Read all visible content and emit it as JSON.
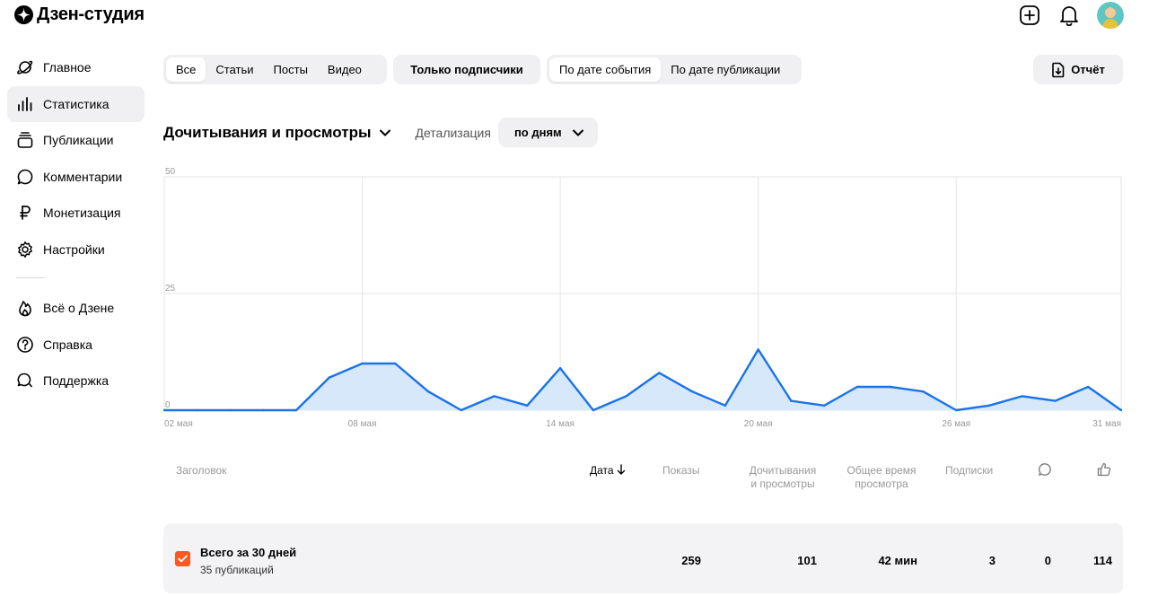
{
  "brand": {
    "name": "Дзен-студия"
  },
  "topbar": {
    "add_icon": "plus-square-icon",
    "bell_icon": "bell-icon"
  },
  "sidebar": {
    "items": [
      {
        "label": "Главное",
        "icon": "planet-icon"
      },
      {
        "label": "Статистика",
        "icon": "bar-chart-icon",
        "active": true
      },
      {
        "label": "Публикации",
        "icon": "stack-icon"
      },
      {
        "label": "Комментарии",
        "icon": "comment-icon"
      },
      {
        "label": "Монетизация",
        "icon": "ruble-icon"
      },
      {
        "label": "Настройки",
        "icon": "gear-icon"
      }
    ],
    "secondary": [
      {
        "label": "Всё о Дзене",
        "icon": "flame-icon"
      },
      {
        "label": "Справка",
        "icon": "question-icon"
      },
      {
        "label": "Поддержка",
        "icon": "chat-icon"
      }
    ]
  },
  "filters": {
    "type_tabs": [
      "Все",
      "Статьи",
      "Посты",
      "Видео"
    ],
    "type_selected": "Все",
    "subscribers_only": "Только подписчики",
    "date_modes": [
      "По дате события",
      "По дате публикации"
    ],
    "date_selected": "По дате события",
    "report_label": "Отчёт"
  },
  "metric": {
    "selected": "Дочитывания и просмотры",
    "detail_label": "Детализация",
    "detail_value": "по дням"
  },
  "chart_data": {
    "type": "area",
    "x": [
      "02 мая",
      "03 мая",
      "04 мая",
      "05 мая",
      "06 мая",
      "07 мая",
      "08 мая",
      "09 мая",
      "10 мая",
      "11 мая",
      "12 мая",
      "13 мая",
      "14 мая",
      "15 мая",
      "16 мая",
      "17 мая",
      "18 мая",
      "19 мая",
      "20 мая",
      "21 мая",
      "22 мая",
      "23 мая",
      "24 мая",
      "25 мая",
      "26 мая",
      "27 мая",
      "28 мая",
      "29 мая",
      "30 мая",
      "31 мая"
    ],
    "values": [
      0,
      0,
      0,
      0,
      0,
      7,
      10,
      10,
      4,
      0,
      3,
      1,
      9,
      0,
      3,
      8,
      4,
      1,
      13,
      2,
      1,
      5,
      5,
      4,
      0,
      1,
      3,
      2,
      5,
      0
    ],
    "x_tick_labels": [
      "02 мая",
      "08 мая",
      "14 мая",
      "20 мая",
      "26 мая",
      "31 мая"
    ],
    "y_ticks": [
      0,
      25,
      50
    ],
    "ylim": [
      0,
      50
    ],
    "color": "#1a73e8",
    "fill": "#d6e8fa"
  },
  "table": {
    "headers": {
      "title": "Заголовок",
      "date": "Дата",
      "shows": "Показы",
      "reads_1": "Дочитывания",
      "reads_2": "и просмотры",
      "time_1": "Общее время",
      "time_2": "просмотра",
      "subs": "Подписки",
      "comments_icon": "comment-icon",
      "likes_icon": "thumbs-up-icon"
    },
    "total": {
      "title": "Всего за 30 дней",
      "subtitle": "35 публикаций",
      "shows": "259",
      "reads": "101",
      "time": "42 мин",
      "subs": "3",
      "comments": "0",
      "likes": "114"
    }
  },
  "colors": {
    "accent": "#ff5722",
    "line": "#1a73e8",
    "area": "#d6e8fa",
    "pill_bg": "#f0f0f2"
  }
}
